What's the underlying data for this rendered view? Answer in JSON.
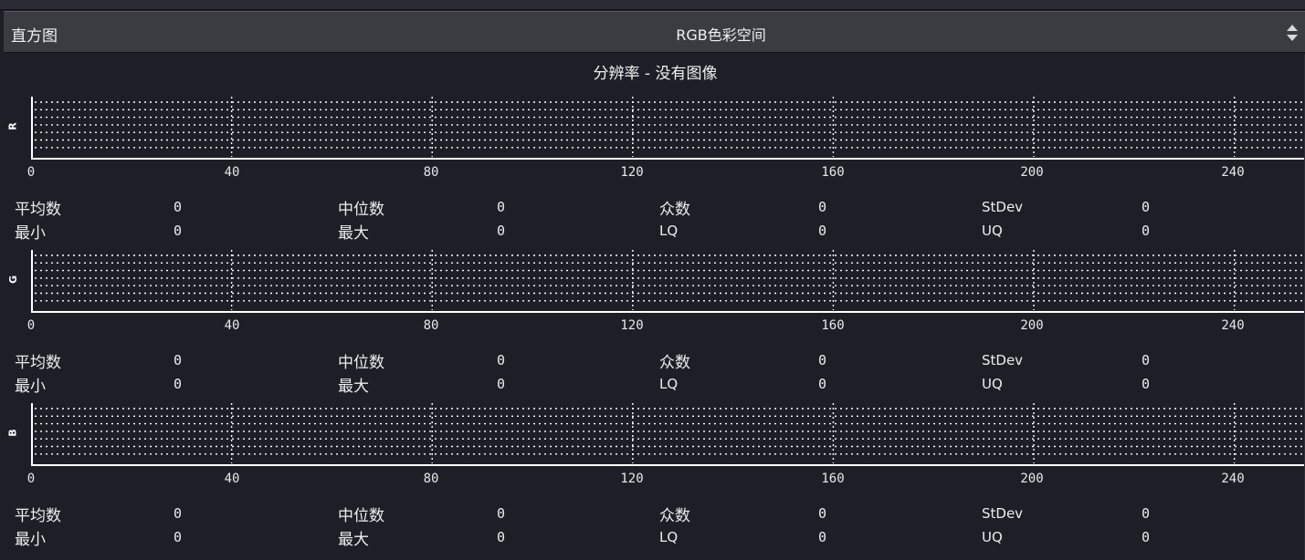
{
  "header": {
    "title": "直方图",
    "mode": "RGB色彩空间"
  },
  "resolution_text": "分辨率 - 没有图像",
  "axis_ticks": [
    "0",
    "40",
    "80",
    "120",
    "160",
    "200",
    "240"
  ],
  "stat_labels": {
    "mean": "平均数",
    "median": "中位数",
    "mode": "众数",
    "stdev": "StDev",
    "min": "最小",
    "max": "最大",
    "lq": "LQ",
    "uq": "UQ"
  },
  "channels": [
    {
      "name": "R",
      "stats": {
        "mean": "0",
        "median": "0",
        "mode": "0",
        "stdev": "0",
        "min": "0",
        "max": "0",
        "lq": "0",
        "uq": "0"
      }
    },
    {
      "name": "G",
      "stats": {
        "mean": "0",
        "median": "0",
        "mode": "0",
        "stdev": "0",
        "min": "0",
        "max": "0",
        "lq": "0",
        "uq": "0"
      }
    },
    {
      "name": "B",
      "stats": {
        "mean": "0",
        "median": "0",
        "mode": "0",
        "stdev": "0",
        "min": "0",
        "max": "0",
        "lq": "0",
        "uq": "0"
      }
    }
  ],
  "colors": {
    "background": "#1e1f26",
    "toolbar": "#3a3c41",
    "grid": "#ffffff",
    "text": "#e6e6e6"
  }
}
